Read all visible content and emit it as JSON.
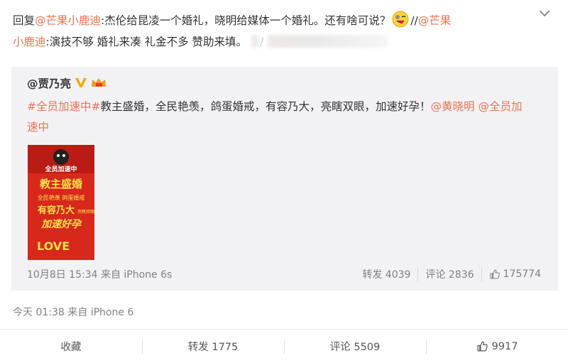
{
  "post": {
    "reply_prefix": "回复",
    "mention_reply": "@芒果小鹿迪",
    "text_1": ":杰伦给昆凌一个婚礼，晓明给媒体一个婚礼。还有啥可说？",
    "sep": "//",
    "mention_repost_a": "@芒果",
    "mention_repost_b": "小鹿迪",
    "text_2": ":演技不够 婚礼来凑 礼金不多 赞助来填。",
    "text_3": "/",
    "emoji_name": "winking-tongue-emoji",
    "timestamp": "今天 01:38 来自 iPhone 6"
  },
  "original": {
    "author": "@贾乃亮",
    "hashtag_1": "#全员加速中#",
    "text": "教主盛婚，全民艳羡，鸽蛋婚戒，有容乃大，亮瞎双眼，加速好孕！",
    "mention_1": "@黄晓明",
    "mention_2": "@全员加",
    "mention_2b": "速中",
    "timestamp": "10月8日 15:34 来自 iPhone 6s",
    "repost_label": "转发 4039",
    "comment_label": "评论 2836",
    "like_count": "175774",
    "thumb_texts": {
      "top": "全员加速中",
      "l1": "教主盛婚",
      "l2": "全民艳羡 鸽蛋婚戒",
      "l3": "有容乃大",
      "l4": "亮瞎双眼",
      "l5": "加速好孕",
      "bottom": "LOVE"
    }
  },
  "actions": {
    "favorite": "收藏",
    "repost": "转发 1775",
    "comment": "评论 5509",
    "like": "9917"
  },
  "colors": {
    "link": "#eb7350",
    "thumb_red": "#d8281c",
    "thumb_yellow": "#ffe14a",
    "box_bg": "#f2f2f5"
  }
}
